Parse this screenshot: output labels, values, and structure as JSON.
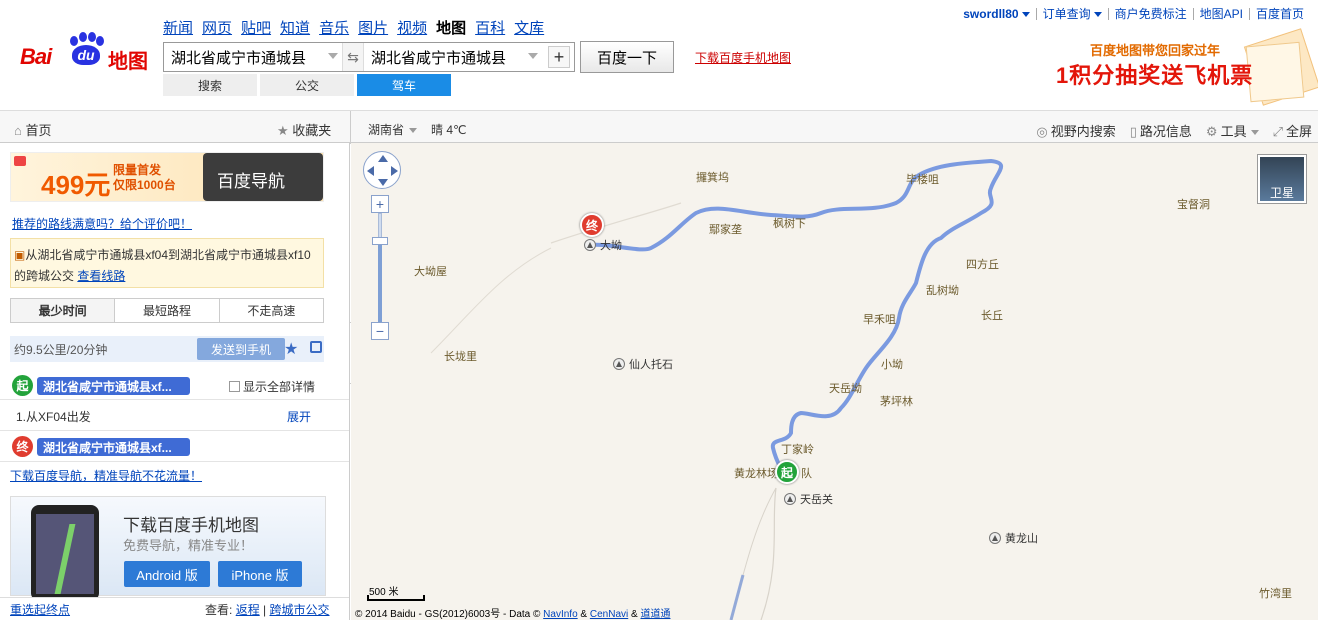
{
  "header": {
    "logo_text": "Bai",
    "logo_du": "du",
    "logo_map": "地图",
    "nav": [
      "新闻",
      "网页",
      "贴吧",
      "知道",
      "音乐",
      "图片",
      "视频",
      "地图",
      "百科",
      "文库"
    ],
    "nav_current": "地图",
    "from_value": "湖北省咸宁市通城县",
    "to_value": "湖北省咸宁市通城县",
    "swap_icon": "swap-icon",
    "add_icon": "plus-icon",
    "search_button": "百度一下",
    "download_mobile": "下载百度手机地图",
    "mode_tabs": [
      "搜索",
      "公交",
      "驾车"
    ],
    "mode_active": "驾车",
    "top_links": {
      "user": "swordll80",
      "orders": "订单查询",
      "merchant": "商户免费标注",
      "api": "地图API",
      "home": "百度首页"
    },
    "promo_line1": "百度地图带您回家过年",
    "promo_line2": "1积分抽奖送飞机票"
  },
  "toolbar": {
    "home": "首页",
    "favorites": "收藏夹",
    "province": "湖南省",
    "weather": "晴 4℃",
    "view_search": "视野内搜索",
    "traffic": "路况信息",
    "tools": "工具",
    "fullscreen": "全屏"
  },
  "panel": {
    "ad_price": "499元",
    "ad_line1": "限量首发",
    "ad_line2": "仅限1000台",
    "ad_product": "百度导航",
    "eval_link": "推荐的路线满意吗？给个评价吧！",
    "route_info": "从湖北省咸宁市通城县xf04到湖北省咸宁市通城县xf10的跨城公交",
    "route_link": "查看线路",
    "options": [
      "最少时间",
      "最短路程",
      "不走高速"
    ],
    "summary": "约9.5公里/20分钟",
    "send_button": "发送到手机",
    "start_label": "起",
    "start_place": "湖北省咸宁市通城县xf...",
    "show_all": "显示全部详情",
    "step1": "1.从XF04出发",
    "expand": "展开",
    "end_label": "终",
    "end_place": "湖北省咸宁市通城县xf...",
    "nav_link": "下载百度导航，精准导航不花流量！",
    "phone_title": "下载百度手机地图",
    "phone_sub": "免费导航，精准专业！",
    "android": "Android 版",
    "iphone": "iPhone 版",
    "reselect": "重选起终点",
    "view_label": "查看:",
    "return_link": "返程",
    "crosscity_link": "跨城市公交"
  },
  "map": {
    "labels": [
      "攞箕坞",
      "毕楼咀",
      "宝督洞",
      "鄢家垄",
      "枫树下",
      "大坳屋",
      "四方丘",
      "乱树坳",
      "长丘",
      "早禾咀",
      "长垅里",
      "小坳",
      "天岳坳",
      "茅坪林",
      "丁家岭",
      "黄龙林场",
      "队",
      "竹湾里"
    ],
    "pois": [
      "大坳",
      "仙人托石",
      "天岳关",
      "黄龙山"
    ],
    "satellite": "卫星",
    "scale": "500 米",
    "copyright": "© 2014 Baidu - GS(2012)6003号 - Data ©",
    "copy_navinfo": "NavInfo",
    "copy_cennavi": "CenNavi",
    "copy_daodao": "道道通",
    "start_pin": "起",
    "end_pin": "终"
  },
  "colors": {
    "route": "#7b9ae0",
    "accent": "#1a8ce6",
    "start": "#23a33b",
    "end": "#e03c2f"
  }
}
